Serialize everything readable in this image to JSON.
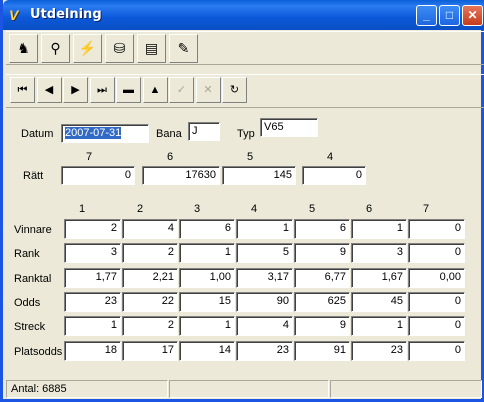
{
  "window": {
    "title": "Utdelning",
    "icon": "V"
  },
  "titlebar_buttons": {
    "minimize": "_",
    "maximize": "□",
    "close": "✕"
  },
  "toolbar": [
    {
      "name": "tool-horse-button",
      "icon": "♞"
    },
    {
      "name": "tool-binoculars-button",
      "icon": "⚲"
    },
    {
      "name": "tool-lightning-button",
      "icon": "⚡"
    },
    {
      "name": "tool-database-button",
      "icon": "⛁"
    },
    {
      "name": "tool-print-button",
      "icon": "▤"
    },
    {
      "name": "tool-edit-button",
      "icon": "✎"
    }
  ],
  "navigator": [
    {
      "name": "nav-first-button",
      "icon": "⏮",
      "enabled": true
    },
    {
      "name": "nav-prior-button",
      "icon": "◀",
      "enabled": true
    },
    {
      "name": "nav-next-button",
      "icon": "▶",
      "enabled": true
    },
    {
      "name": "nav-last-button",
      "icon": "⏭",
      "enabled": true
    },
    {
      "name": "nav-delete-button",
      "icon": "▬",
      "enabled": true
    },
    {
      "name": "nav-edit-button",
      "icon": "▲",
      "enabled": true
    },
    {
      "name": "nav-post-button",
      "icon": "✓",
      "enabled": false
    },
    {
      "name": "nav-cancel-button",
      "icon": "✕",
      "enabled": false
    },
    {
      "name": "nav-refresh-button",
      "icon": "↻",
      "enabled": true
    }
  ],
  "form": {
    "datum_label": "Datum",
    "datum_value": "2007-07-31",
    "bana_label": "Bana",
    "bana_value": "J",
    "typ_label": "Typ",
    "typ_value": "V65",
    "ratt_label": "Rätt",
    "ratt_headers": [
      "7",
      "6",
      "5",
      "4"
    ],
    "ratt_values": [
      "0",
      "17630",
      "145",
      "0"
    ]
  },
  "grid": {
    "column_headers": [
      "1",
      "2",
      "3",
      "4",
      "5",
      "6",
      "7"
    ],
    "rows": [
      {
        "label": "Vinnare",
        "values": [
          "2",
          "4",
          "6",
          "1",
          "6",
          "1",
          "0"
        ]
      },
      {
        "label": "Rank",
        "values": [
          "3",
          "2",
          "1",
          "5",
          "9",
          "3",
          "0"
        ]
      },
      {
        "label": "Ranktal",
        "values": [
          "1,77",
          "2,21",
          "1,00",
          "3,17",
          "6,77",
          "1,67",
          "0,00"
        ]
      },
      {
        "label": "Odds",
        "values": [
          "23",
          "22",
          "15",
          "90",
          "625",
          "45",
          "0"
        ]
      },
      {
        "label": "Streck",
        "values": [
          "1",
          "2",
          "1",
          "4",
          "9",
          "1",
          "0"
        ]
      },
      {
        "label": "Platsodds",
        "values": [
          "18",
          "17",
          "14",
          "23",
          "91",
          "23",
          "0"
        ]
      }
    ]
  },
  "statusbar": {
    "count": "Antal: 6885",
    "panel2": "",
    "panel3": ""
  }
}
